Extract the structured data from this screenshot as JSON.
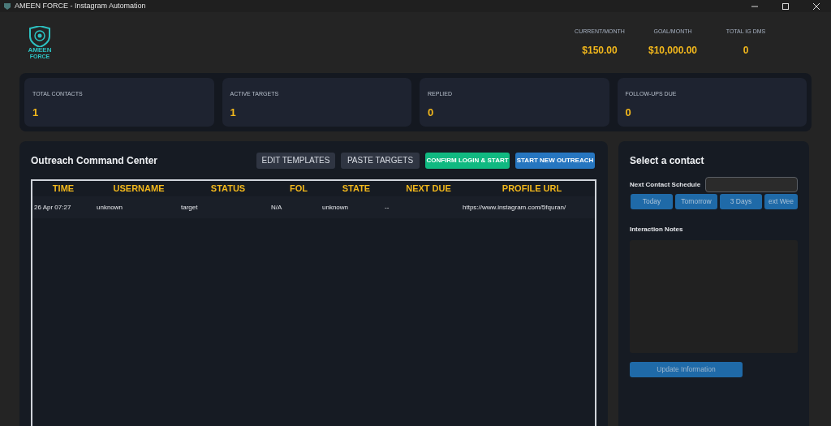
{
  "window": {
    "title": "AMEEN FORCE - Instagram Automation"
  },
  "logo": {
    "lines": [
      "AMEEN",
      "FORCE"
    ]
  },
  "header_stats": [
    {
      "label": "CURRENT/MONTH",
      "value": "$150.00"
    },
    {
      "label": "GOAL/MONTH",
      "value": "$10,000.00"
    },
    {
      "label": "TOTAL IG DMS",
      "value": "0"
    }
  ],
  "summary_cards": [
    {
      "label": "TOTAL CONTACTS",
      "value": "1"
    },
    {
      "label": "ACTIVE TARGETS",
      "value": "1"
    },
    {
      "label": "REPLIED",
      "value": "0"
    },
    {
      "label": "FOLLOW-UPS DUE",
      "value": "0"
    }
  ],
  "outreach": {
    "title": "Outreach Command Center",
    "buttons": [
      {
        "label": "EDIT TEMPLATES",
        "kind": "neutral"
      },
      {
        "label": "PASTE TARGETS",
        "kind": "neutral"
      },
      {
        "label": "CONFIRM LOGIN & START",
        "kind": "success"
      },
      {
        "label": "START NEW OUTREACH",
        "kind": "primary"
      }
    ],
    "table": {
      "columns": [
        "TIME",
        "USERNAME",
        "STATUS",
        "FOL",
        "STATE",
        "NEXT DUE",
        "PROFILE URL"
      ],
      "rows": [
        [
          "26 Apr 07:27",
          "unknown",
          "target",
          "N/A",
          "unknown",
          "--",
          "https://www.instagram.com/5fquran/"
        ]
      ]
    }
  },
  "contact_panel": {
    "title": "Select a contact",
    "schedule_label": "Next Contact Schedule",
    "quick_buttons": [
      "Today",
      "Tomorrow",
      "3 Days",
      "ext Wee"
    ],
    "notes_label": "Interaction Notes",
    "update_button": "Update Information"
  }
}
